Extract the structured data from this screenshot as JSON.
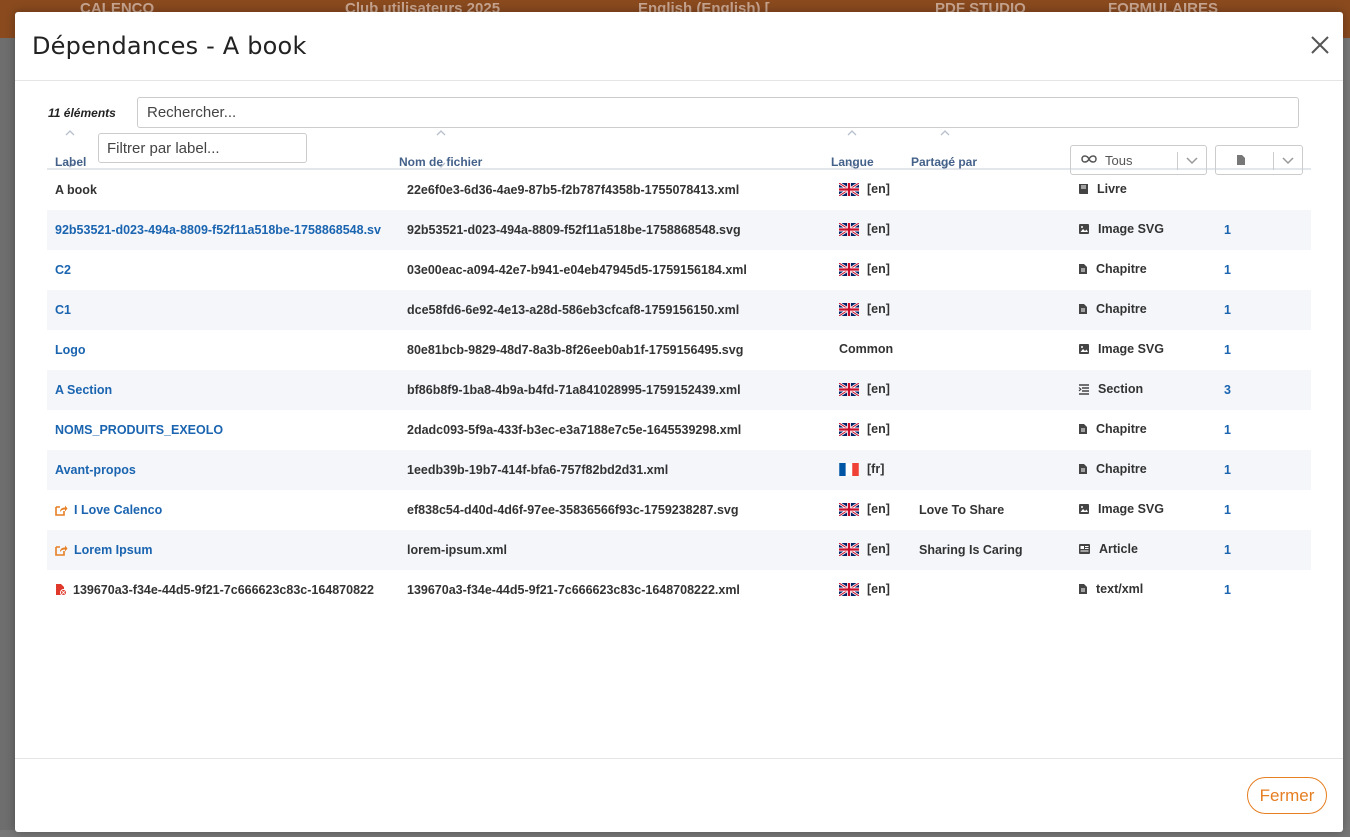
{
  "background": {
    "topbar_segments": [
      "CALENCO",
      "Club utilisateurs 2025",
      "English (English) [",
      "PDF STUDIO",
      "FORMULAIRES"
    ]
  },
  "modal": {
    "title": "Dépendances - A book",
    "count": "11 éléments",
    "search_placeholder": "Rechercher...",
    "columns": {
      "label": "Label",
      "label_filter_placeholder": "Filtrer par label...",
      "file": "Nom de fichier",
      "lang": "Langue",
      "shared": "Partagé par",
      "type_filter": "Tous"
    },
    "rows": [
      {
        "label": "A book",
        "label_style": "plain",
        "label_icon": "",
        "file": "22e6f0e3-6d36-4ae9-87b5-f2b787f4358b-1755078413.xml",
        "flag": "gb",
        "lang": "[en]",
        "shared": "",
        "type_icon": "book-icon",
        "type": "Livre",
        "count": ""
      },
      {
        "label": "92b53521-d023-494a-8809-f52f11a518be-1758868548.sv",
        "label_style": "link",
        "label_icon": "",
        "file": "92b53521-d023-494a-8809-f52f11a518be-1758868548.svg",
        "flag": "gb",
        "lang": "[en]",
        "shared": "",
        "type_icon": "image-icon",
        "type": "Image SVG",
        "count": "1"
      },
      {
        "label": "C2",
        "label_style": "link",
        "label_icon": "",
        "file": "03e00eac-a094-42e7-b941-e04eb47945d5-1759156184.xml",
        "flag": "gb",
        "lang": "[en]",
        "shared": "",
        "type_icon": "document-icon",
        "type": "Chapitre",
        "count": "1"
      },
      {
        "label": "C1",
        "label_style": "link",
        "label_icon": "",
        "file": "dce58fd6-6e92-4e13-a28d-586eb3cfcaf8-1759156150.xml",
        "flag": "gb",
        "lang": "[en]",
        "shared": "",
        "type_icon": "document-icon",
        "type": "Chapitre",
        "count": "1"
      },
      {
        "label": "Logo",
        "label_style": "link",
        "label_icon": "",
        "file": "80e81bcb-9829-48d7-8a3b-8f26eeb0ab1f-1759156495.svg",
        "flag": "",
        "lang": "Common",
        "shared": "",
        "type_icon": "image-icon",
        "type": "Image SVG",
        "count": "1"
      },
      {
        "label": "A Section",
        "label_style": "link",
        "label_icon": "",
        "file": "bf86b8f9-1ba8-4b9a-b4fd-71a841028995-1759152439.xml",
        "flag": "gb",
        "lang": "[en]",
        "shared": "",
        "type_icon": "section-icon",
        "type": "Section",
        "count": "3"
      },
      {
        "label": "NOMS_PRODUITS_EXEOLO",
        "label_style": "link",
        "label_icon": "",
        "file": "2dadc093-5f9a-433f-b3ec-e3a7188e7c5e-1645539298.xml",
        "flag": "gb",
        "lang": "[en]",
        "shared": "",
        "type_icon": "document-icon",
        "type": "Chapitre",
        "count": "1"
      },
      {
        "label": "Avant-propos",
        "label_style": "link",
        "label_icon": "",
        "file": "1eedb39b-19b7-414f-bfa6-757f82bd2d31.xml",
        "flag": "fr",
        "lang": "[fr]",
        "shared": "",
        "type_icon": "document-icon",
        "type": "Chapitre",
        "count": "1"
      },
      {
        "label": "I Love Calenco",
        "label_style": "link",
        "label_icon": "share-icon",
        "file": "ef838c54-d40d-4d6f-97ee-35836566f93c-1759238287.svg",
        "flag": "gb",
        "lang": "[en]",
        "shared": "Love To Share",
        "type_icon": "image-icon",
        "type": "Image SVG",
        "count": "1"
      },
      {
        "label": "Lorem Ipsum",
        "label_style": "link",
        "label_icon": "share-icon",
        "file": "lorem-ipsum.xml",
        "flag": "gb",
        "lang": "[en]",
        "shared": "Sharing Is Caring",
        "type_icon": "article-icon",
        "type": "Article",
        "count": "1"
      },
      {
        "label": "139670a3-f34e-44d5-9f21-7c666623c83c-164870822",
        "label_style": "plain",
        "label_icon": "missing-file-icon",
        "file": "139670a3-f34e-44d5-9f21-7c666623c83c-1648708222.xml",
        "flag": "gb",
        "lang": "[en]",
        "shared": "",
        "type_icon": "document-icon",
        "type": "text/xml",
        "count": "1"
      }
    ],
    "close_label": "Fermer"
  },
  "colors": {
    "accent": "#e67e22",
    "link": "#1a64b0",
    "header_text": "#44618a",
    "alt_row": "#f4f6fa"
  }
}
